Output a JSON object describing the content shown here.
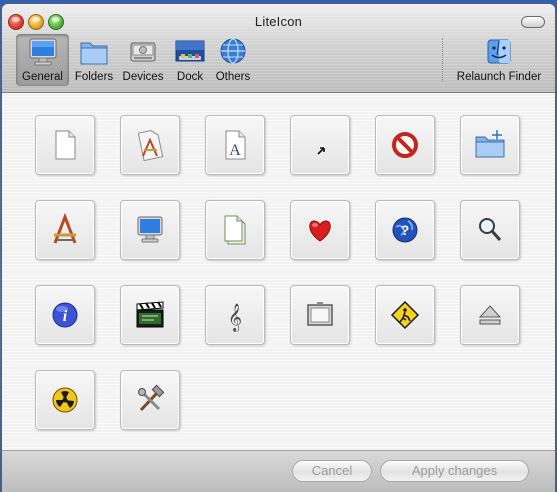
{
  "window": {
    "title": "LiteIcon"
  },
  "toolbar": {
    "items": [
      {
        "label": "General",
        "icon": "monitor-icon",
        "selected": true
      },
      {
        "label": "Folders",
        "icon": "folder-icon"
      },
      {
        "label": "Devices",
        "icon": "hard-drive-icon"
      },
      {
        "label": "Dock",
        "icon": "dock-icon"
      },
      {
        "label": "Others",
        "icon": "network-globe-icon"
      }
    ],
    "relaunch": {
      "label": "Relaunch Finder",
      "icon": "finder-icon"
    }
  },
  "icons": [
    {
      "name": "generic-document-icon"
    },
    {
      "name": "application-document-icon"
    },
    {
      "name": "font-document-icon"
    },
    {
      "name": "alias-arrow-icon"
    },
    {
      "name": "prohibited-icon"
    },
    {
      "name": "new-folder-icon"
    },
    {
      "name": "application-icon"
    },
    {
      "name": "computer-icon"
    },
    {
      "name": "stationery-icon"
    },
    {
      "name": "favorites-heart-icon"
    },
    {
      "name": "help-icon"
    },
    {
      "name": "magnifier-icon"
    },
    {
      "name": "info-icon"
    },
    {
      "name": "clapperboard-icon"
    },
    {
      "name": "music-note-icon"
    },
    {
      "name": "desktop-picture-icon"
    },
    {
      "name": "caution-sign-icon"
    },
    {
      "name": "eject-icon"
    },
    {
      "name": "burn-icon"
    },
    {
      "name": "tools-icon"
    }
  ],
  "buttons": {
    "cancel": "Cancel",
    "apply": "Apply changes"
  },
  "colors": {
    "accent_blue": "#3f7ad0",
    "selected_tab": "#a8a8a8",
    "disabled_text": "#9a9a9a"
  }
}
